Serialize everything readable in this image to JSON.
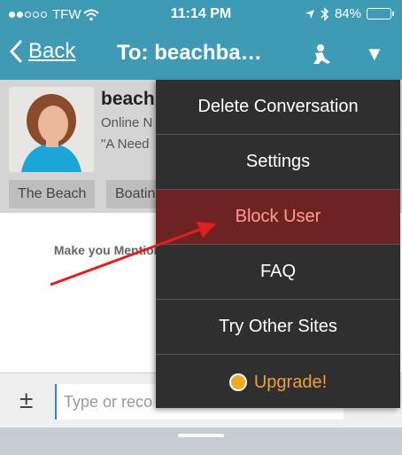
{
  "status_bar": {
    "carrier": "TFW",
    "time": "11:14 PM",
    "battery": "84%",
    "battery_level": 0.84
  },
  "nav": {
    "back_label": "Back",
    "title": "To: beachba…"
  },
  "profile": {
    "name": "beach",
    "subtitle": "Online N",
    "quote": "\"A Need",
    "tags": [
      "The Beach",
      "Boatin"
    ]
  },
  "hint": {
    "text": "Make you Mention so their p"
  },
  "composer": {
    "plus_minus": "±",
    "placeholder": "Type or reco"
  },
  "menu": {
    "items": [
      {
        "label": "Delete Conversation"
      },
      {
        "label": "Settings"
      },
      {
        "label": "Block User"
      },
      {
        "label": "FAQ"
      },
      {
        "label": "Try Other Sites"
      },
      {
        "label": "Upgrade!"
      }
    ]
  },
  "colors": {
    "nav_bg": "#3f9bb5",
    "menu_bg": "#2f2f2f",
    "highlight_bg": "#6e2323",
    "highlight_text": "#ff9a9a",
    "upgrade": "#f0a030",
    "arrow": "#e02020"
  }
}
